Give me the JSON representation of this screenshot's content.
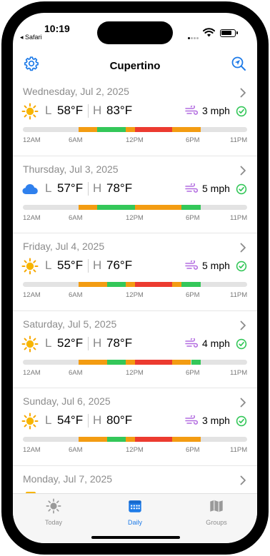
{
  "status_bar": {
    "time": "10:19",
    "back_app": "◂ Safari"
  },
  "nav": {
    "title": "Cupertino",
    "left_icon": "gear-icon",
    "right_icon": "location-search-icon"
  },
  "days": [
    {
      "date": "Wednesday, Jul 2, 2025",
      "icon": "sun-icon",
      "low_label": "L",
      "low": "58°F",
      "high_label": "H",
      "high": "83°F",
      "wind": "3 mph",
      "wind_status": "good"
    },
    {
      "date": "Thursday, Jul 3, 2025",
      "icon": "cloud-icon",
      "low_label": "L",
      "low": "57°F",
      "high_label": "H",
      "high": "78°F",
      "wind": "5 mph",
      "wind_status": "good"
    },
    {
      "date": "Friday, Jul 4, 2025",
      "icon": "sun-icon",
      "low_label": "L",
      "low": "55°F",
      "high_label": "H",
      "high": "76°F",
      "wind": "5 mph",
      "wind_status": "good"
    },
    {
      "date": "Saturday, Jul 5, 2025",
      "icon": "sun-icon",
      "low_label": "L",
      "low": "52°F",
      "high_label": "H",
      "high": "78°F",
      "wind": "4 mph",
      "wind_status": "good"
    },
    {
      "date": "Sunday, Jul 6, 2025",
      "icon": "sun-icon",
      "low_label": "L",
      "low": "54°F",
      "high_label": "H",
      "high": "80°F",
      "wind": "3 mph",
      "wind_status": "good"
    },
    {
      "date": "Monday, Jul 7, 2025",
      "icon": "sun-icon"
    }
  ],
  "timeline_ticks": [
    "12AM",
    "6AM",
    "12PM",
    "6PM",
    "11PM"
  ],
  "comfort_colors": {
    "fair": "#f39c12",
    "good": "#34c759",
    "poor": "#ec3b30",
    "none": "#e3e3e3"
  },
  "tabs": [
    {
      "label": "Today",
      "icon": "sun-icon",
      "active": false
    },
    {
      "label": "Daily",
      "icon": "calendar-icon",
      "active": true
    },
    {
      "label": "Groups",
      "icon": "map-icon",
      "active": false
    }
  ]
}
